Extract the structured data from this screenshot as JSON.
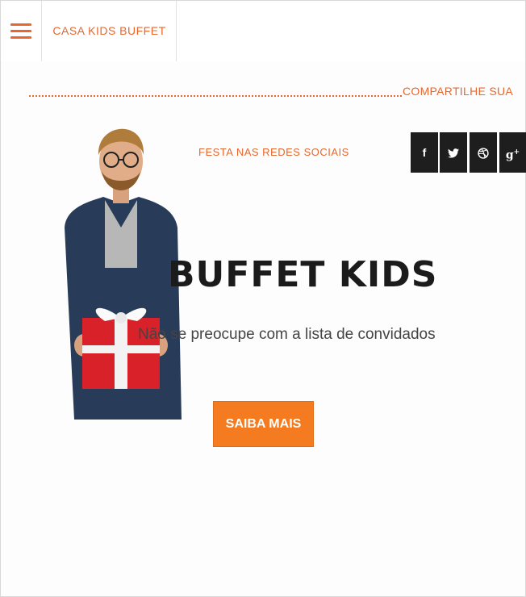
{
  "header": {
    "brand": "CASA KIDS BUFFET",
    "menu_icon": "hamburger-menu-icon"
  },
  "share": {
    "title": "COMPARTILHE SUA",
    "subtitle": "FESTA NAS REDES SOCIAIS",
    "networks": [
      {
        "icon": "facebook-icon",
        "glyph": "f"
      },
      {
        "icon": "twitter-icon",
        "glyph": "🐦"
      },
      {
        "icon": "dribbble-icon",
        "glyph": "◍"
      },
      {
        "icon": "google-plus-icon",
        "glyph": "g⁺"
      }
    ]
  },
  "hero": {
    "title": "BUFFET KIDS",
    "subtitle": "Não se preocupe com a lista de convidados",
    "cta_label": "SAIBA MAIS"
  },
  "colors": {
    "accent": "#e8672c",
    "button": "#f47b20",
    "dark": "#1e1e1e"
  }
}
